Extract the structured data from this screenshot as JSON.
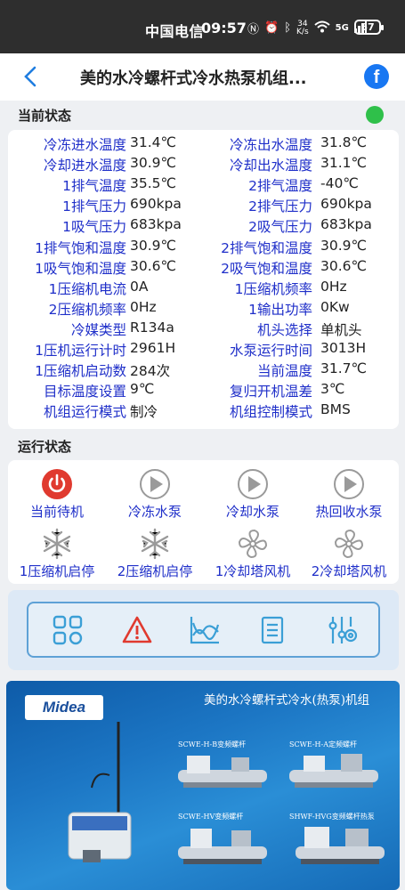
{
  "status_bar": {
    "carrier": "中国电信",
    "time": "09:57",
    "net_speed_value": "34",
    "net_speed_unit": "K/s",
    "signal_label": "5G",
    "battery": "57"
  },
  "header": {
    "title": "美的水冷螺杆式冷水热泵机组..."
  },
  "current_status": {
    "title": "当前状态",
    "indicator_color": "#2fc04a",
    "rows": [
      {
        "l_label": "冷冻进水温度",
        "l_value": "31.4℃",
        "r_label": "冷冻出水温度",
        "r_value": "31.8℃"
      },
      {
        "l_label": "冷却进水温度",
        "l_value": "30.9℃",
        "r_label": "冷却出水温度",
        "r_value": "31.1℃"
      },
      {
        "l_label": "1排气温度",
        "l_value": "35.5℃",
        "r_label": "2排气温度",
        "r_value": "-40℃"
      },
      {
        "l_label": "1排气压力",
        "l_value": "690kpa",
        "r_label": "2排气压力",
        "r_value": "690kpa"
      },
      {
        "l_label": "1吸气压力",
        "l_value": "683kpa",
        "r_label": "2吸气压力",
        "r_value": "683kpa"
      },
      {
        "l_label": "1排气饱和温度",
        "l_value": "30.9℃",
        "r_label": "2排气饱和温度",
        "r_value": "30.9℃"
      },
      {
        "l_label": "1吸气饱和温度",
        "l_value": "30.6℃",
        "r_label": "2吸气饱和温度",
        "r_value": "30.6℃"
      },
      {
        "l_label": "1压缩机电流",
        "l_value": "0A",
        "r_label": "1压缩机频率",
        "r_value": "0Hz"
      },
      {
        "l_label": "2压缩机频率",
        "l_value": "0Hz",
        "r_label": "1输出功率",
        "r_value": "0Kw"
      },
      {
        "l_label": "冷媒类型",
        "l_value": "R134a",
        "r_label": "机头选择",
        "r_value": "单机头"
      },
      {
        "l_label": "1压机运行计时",
        "l_value": "2961H",
        "r_label": "水泵运行时间",
        "r_value": "3013H"
      },
      {
        "l_label": "1压缩机启动数",
        "l_value": "284次",
        "r_label": "当前温度",
        "r_value": "31.7℃"
      },
      {
        "l_label": "目标温度设置",
        "l_value": "9℃",
        "r_label": "复归开机温差",
        "r_value": "3℃"
      },
      {
        "l_label": "机组运行模式",
        "l_value": "制冷",
        "r_label": "机组控制模式",
        "r_value": "BMS"
      }
    ]
  },
  "run_status": {
    "title": "运行状态",
    "items": [
      {
        "label": "当前待机",
        "icon": "power-icon",
        "color": "#e03a2f"
      },
      {
        "label": "冷冻水泵",
        "icon": "play-icon",
        "color": "#9a9a9a"
      },
      {
        "label": "冷却水泵",
        "icon": "play-icon",
        "color": "#9a9a9a"
      },
      {
        "label": "热回收水泵",
        "icon": "play-icon",
        "color": "#9a9a9a"
      },
      {
        "label": "1压缩机启停",
        "icon": "snowflake-icon",
        "color": "#9a9a9a"
      },
      {
        "label": "2压缩机启停",
        "icon": "snowflake-icon",
        "color": "#9a9a9a"
      },
      {
        "label": "1冷却塔风机",
        "icon": "fan-icon",
        "color": "#9a9a9a"
      },
      {
        "label": "2冷却塔风机",
        "icon": "fan-icon",
        "color": "#9a9a9a"
      }
    ]
  },
  "toolbar": {
    "accent": "#3b9fd6",
    "items": [
      {
        "icon": "grid-icon"
      },
      {
        "icon": "alarm-warning-icon",
        "color": "#e03a2f"
      },
      {
        "icon": "trend-chart-icon"
      },
      {
        "icon": "document-list-icon"
      },
      {
        "icon": "settings-sliders-icon"
      }
    ]
  },
  "banner": {
    "logo": "Midea",
    "title": "美的水冷螺杆式冷水(热泵)机组",
    "models": [
      "SCWE-H-B变频螺杆",
      "SCWE-H-A定频螺杆",
      "SCWE-HV变频螺杆",
      "SHWF-HVG变频螺杆热泵"
    ]
  }
}
